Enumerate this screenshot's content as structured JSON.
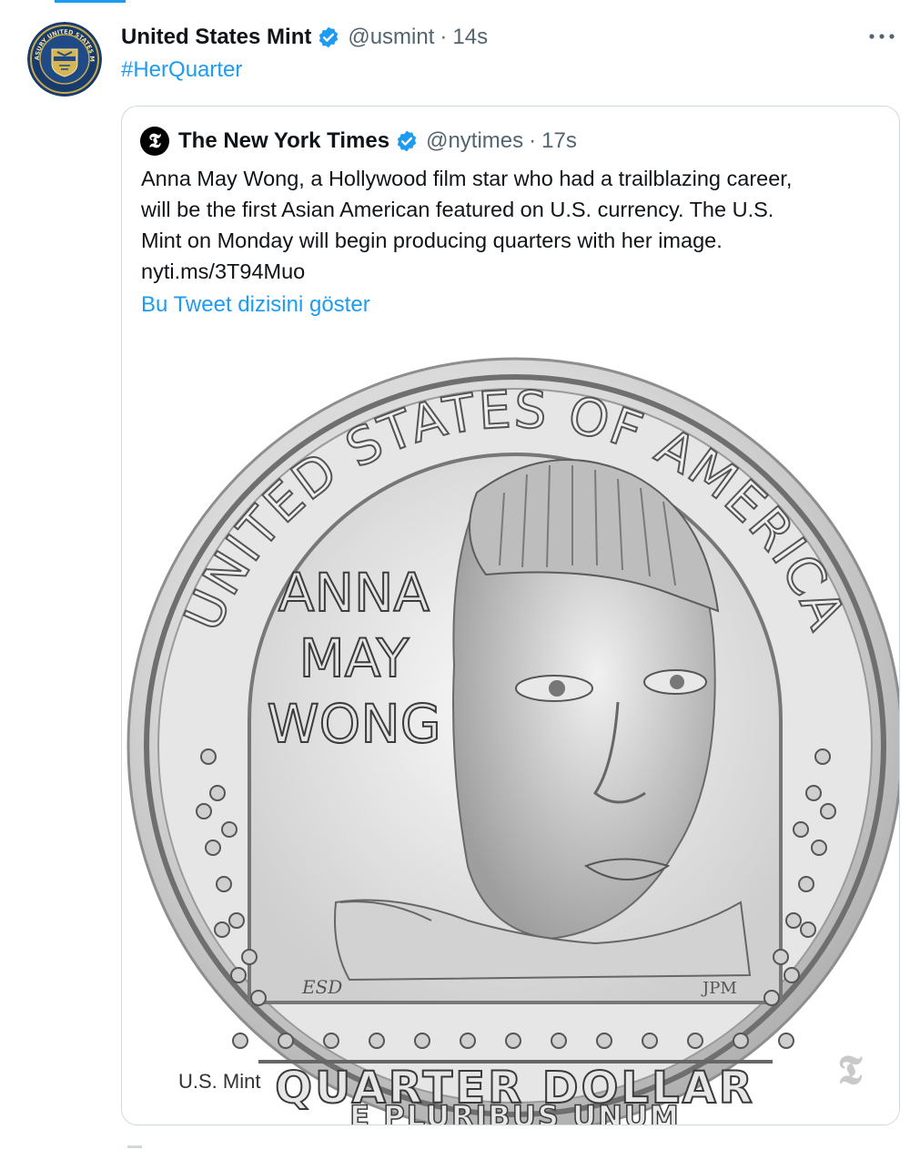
{
  "tweet": {
    "display_name": "United States Mint",
    "handle": "@usmint",
    "separator": "·",
    "time": "14s",
    "hashtag": "#HerQuarter",
    "more_icon": "more-horizontal-icon",
    "avatar_icon": "treasury-seal-icon",
    "avatar_text": "TREASURY UNITED STATES MINT"
  },
  "quoted_tweet": {
    "display_name": "The New York Times",
    "handle": "@nytimes",
    "separator": "·",
    "time": "17s",
    "avatar_icon": "nyt-logo-icon",
    "text_lines": [
      "Anna May Wong, a Hollywood film star who had a trailblazing career,",
      "will be the first Asian American featured on U.S. currency. The U.S.",
      "Mint on Monday will begin producing quarters with her image.",
      "nyti.ms/3T94Muo"
    ],
    "thread_link": "Bu Tweet dizisini göster",
    "media": {
      "description_icon": "quarter-coin-image",
      "coin_top_text": "UNITED STATES OF AMERICA",
      "coin_name_lines": [
        "ANNA",
        "MAY",
        "WONG"
      ],
      "coin_initials_left": "ESD",
      "coin_initials_right": "JPM",
      "coin_denomination": "QUARTER DOLLAR",
      "coin_motto": "E PLURIBUS UNUM",
      "credit": "U.S. Mint",
      "watermark_icon": "nyt-watermark-icon"
    }
  },
  "colors": {
    "accent": "#1d9bf0",
    "text_primary": "#0f1419",
    "text_secondary": "#536471",
    "border": "#cfd9de"
  }
}
